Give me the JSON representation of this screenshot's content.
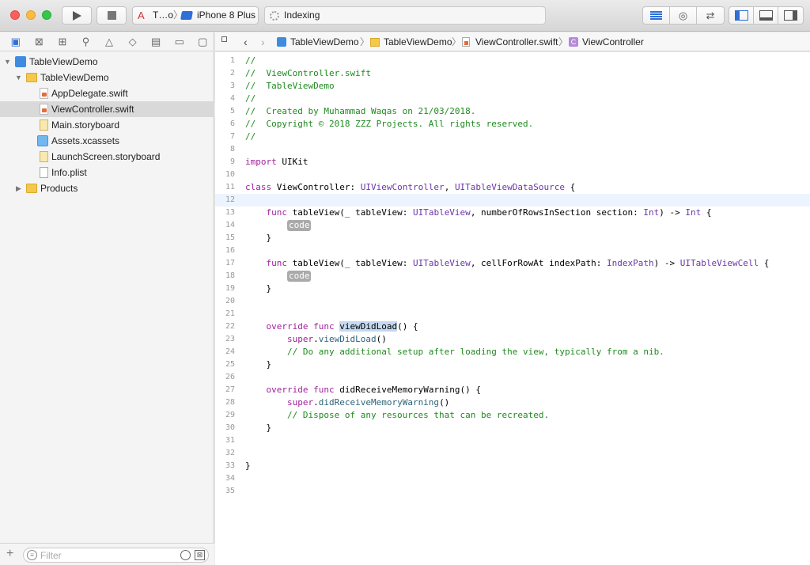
{
  "toolbar": {
    "scheme_name": "T…o",
    "separator": "〉",
    "device": "iPhone 8 Plus",
    "activity_text": "Indexing"
  },
  "navigator": {
    "filter_placeholder": "Filter",
    "items": [
      {
        "label": "TableViewDemo",
        "icon": "project-icon",
        "level": 0,
        "expanded": true
      },
      {
        "label": "TableViewDemo",
        "icon": "folder-icon",
        "level": 1,
        "expanded": true
      },
      {
        "label": "AppDelegate.swift",
        "icon": "swift-file-icon",
        "level": 2
      },
      {
        "label": "ViewController.swift",
        "icon": "swift-file-icon",
        "level": 2,
        "selected": true
      },
      {
        "label": "Main.storyboard",
        "icon": "storyboard-icon",
        "level": 2
      },
      {
        "label": "Assets.xcassets",
        "icon": "assets-icon",
        "level": 2
      },
      {
        "label": "LaunchScreen.storyboard",
        "icon": "storyboard-icon",
        "level": 2
      },
      {
        "label": "Info.plist",
        "icon": "plist-icon",
        "level": 2
      },
      {
        "label": "Products",
        "icon": "folder-icon",
        "level": 1,
        "expanded": false
      }
    ]
  },
  "jumpbar": {
    "crumbs": [
      "TableViewDemo",
      "TableViewDemo",
      "ViewController.swift",
      "ViewController"
    ],
    "class_icon_letter": "C"
  },
  "editor": {
    "current_line": 12,
    "placeholder": "code",
    "lines": [
      "//",
      "//  ViewController.swift",
      "//  TableViewDemo",
      "//",
      "//  Created by Muhammad Waqas on 21/03/2018.",
      "//  Copyright © 2018 ZZZ Projects. All rights reserved.",
      "//",
      "",
      "import UIKit",
      "",
      "class ViewController: UIViewController, UITableViewDataSource {",
      "",
      "    func tableView(_ tableView: UITableView, numberOfRowsInSection section: Int) -> Int {",
      "        code",
      "    }",
      "",
      "    func tableView(_ tableView: UITableView, cellForRowAt indexPath: IndexPath) -> UITableViewCell {",
      "        code",
      "    }",
      "",
      "",
      "    override func viewDidLoad() {",
      "        super.viewDidLoad()",
      "        // Do any additional setup after loading the view, typically from a nib.",
      "    }",
      "",
      "    override func didReceiveMemoryWarning() {",
      "        super.didReceiveMemoryWarning()",
      "        // Dispose of any resources that can be recreated.",
      "    }",
      "",
      "",
      "}",
      "",
      ""
    ]
  }
}
